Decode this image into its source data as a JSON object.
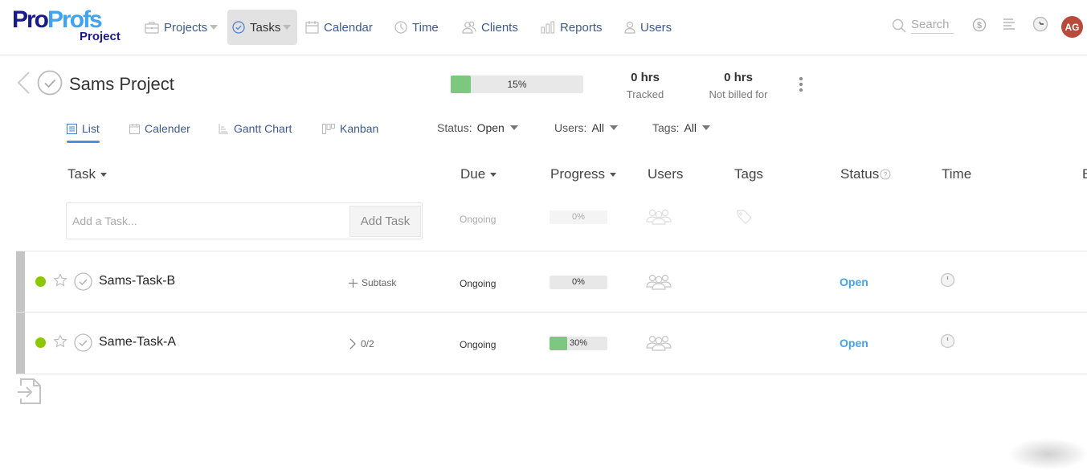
{
  "brand": {
    "name_part1": "Pro",
    "name_part2": "Profs",
    "product": "Project"
  },
  "nav": {
    "items": [
      {
        "label": "Projects",
        "icon": "briefcase-icon",
        "has_caret": true
      },
      {
        "label": "Tasks",
        "icon": "check-circle-icon",
        "has_caret": true,
        "active": true
      },
      {
        "label": "Calendar",
        "icon": "calendar-icon"
      },
      {
        "label": "Time",
        "icon": "clock-icon"
      },
      {
        "label": "Clients",
        "icon": "clients-icon"
      },
      {
        "label": "Reports",
        "icon": "bar-chart-icon"
      },
      {
        "label": "Users",
        "icon": "user-icon"
      }
    ],
    "search_placeholder": "Search",
    "avatar_initials": "AG"
  },
  "project": {
    "title": "Sams Project",
    "progress_percent": 15,
    "progress_label": "15%",
    "tracked_value": "0 hrs",
    "tracked_label": "Tracked",
    "not_billed_value": "0 hrs",
    "not_billed_label": "Not billed for"
  },
  "views": [
    {
      "label": "List",
      "active": true
    },
    {
      "label": "Calender"
    },
    {
      "label": "Gantt Chart"
    },
    {
      "label": "Kanban"
    }
  ],
  "filters": {
    "status_label": "Status:",
    "status_value": "Open",
    "users_label": "Users:",
    "users_value": "All",
    "tags_label": "Tags:",
    "tags_value": "All"
  },
  "columns": {
    "task": "Task",
    "due": "Due",
    "progress": "Progress",
    "users": "Users",
    "tags": "Tags",
    "status": "Status",
    "time": "Time",
    "extra": "B"
  },
  "add_task": {
    "placeholder": "Add a Task...",
    "button": "Add Task",
    "due": "Ongoing",
    "progress_label": "0%"
  },
  "tasks": [
    {
      "name": "Sams-Task-B",
      "subtask_label": "Subtask",
      "subtask_type": "add",
      "due": "Ongoing",
      "progress_percent": 0,
      "progress_label": "0%",
      "status": "Open"
    },
    {
      "name": "Same-Task-A",
      "subtask_label": "0/2",
      "subtask_type": "expand",
      "due": "Ongoing",
      "progress_percent": 30,
      "progress_label": "30%",
      "status": "Open"
    }
  ],
  "colors": {
    "brand_dark": "#1a1a8c",
    "brand_light": "#3fa3f2",
    "progress_fill": "#7dc77f",
    "status_open": "#3fa3f2",
    "priority_dot": "#8cc800",
    "avatar_bg": "#b84b3c"
  }
}
